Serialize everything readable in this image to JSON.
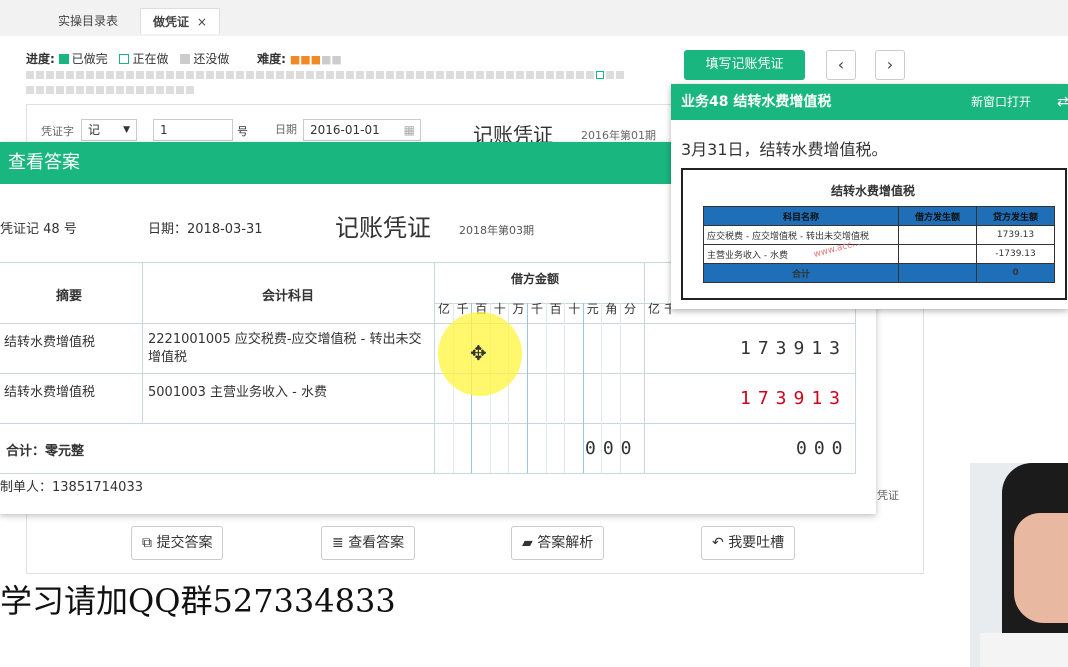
{
  "tabs": [
    {
      "label": "实操目录表"
    },
    {
      "label": "做凭证",
      "close": "×"
    }
  ],
  "progress": {
    "label": "进度:",
    "done": "已做完",
    "doing": "正在做",
    "todo": "还没做",
    "difficulty_label": "难度:",
    "difficulty": 0.6,
    "colors": {
      "done": "#1ab67f",
      "doing": "#1ab67f",
      "todo": "#cccccc"
    }
  },
  "toolbar": {
    "fill_btn": "填写记账凭证",
    "prev": "‹",
    "next": "›"
  },
  "bgform": {
    "voucher_word_label": "凭证字",
    "voucher_word": "记",
    "number": "1",
    "number_unit": "号",
    "date_label": "日期",
    "date": "2016-01-01",
    "title": "记账凭证",
    "period": "2016年第01期",
    "side_text": "凭证"
  },
  "modal": {
    "title": "查看答案",
    "voucher_no": "凭证记 48 号",
    "date": "日期：2018-03-31",
    "title_center": "记账凭证",
    "period": "2018年第03期",
    "headers": {
      "summary": "摘要",
      "account": "会计科目",
      "debit": "借方金额",
      "units": [
        "亿",
        "千",
        "百",
        "十",
        "万",
        "千",
        "百",
        "十",
        "元",
        "角",
        "分"
      ],
      "credit_units_first": "亿",
      "credit_units_second": "千"
    },
    "rows": [
      {
        "summary": "结转水费增值税",
        "account": "2221001005 应交税费-应交增值税 - 转出未交增值税",
        "amount": "173913",
        "amount_color": "#333333"
      },
      {
        "summary": "结转水费增值税",
        "account": "5001003 主营业务收入 - 水费",
        "amount": "173913",
        "amount_color": "#d0021b"
      }
    ],
    "total_label": "合计：零元整",
    "total_debit": "000",
    "total_credit": "000",
    "preparer": "制单人：13851714033"
  },
  "popup": {
    "title": "业务48 结转水费增值税",
    "newwin": "新窗口打开",
    "desc": "3月31日，结转水费增值税。",
    "sheet_title": "结转水费增值税",
    "cols": [
      "科目名称",
      "借方发生额",
      "贷方发生额"
    ],
    "rows": [
      [
        "应交税费 - 应交增值税 - 转出未交增值税",
        "",
        "1739.13"
      ],
      [
        "主营业务收入 - 水费",
        "",
        "-1739.13"
      ]
    ],
    "total": [
      "合计",
      "",
      "0"
    ],
    "watermark": "www.acc..."
  },
  "buttons": {
    "submit": "提交答案",
    "view": "查看答案",
    "analysis": "答案解析",
    "feedback": "我要吐槽"
  },
  "overlay_text": "学习请加QQ群527334833"
}
